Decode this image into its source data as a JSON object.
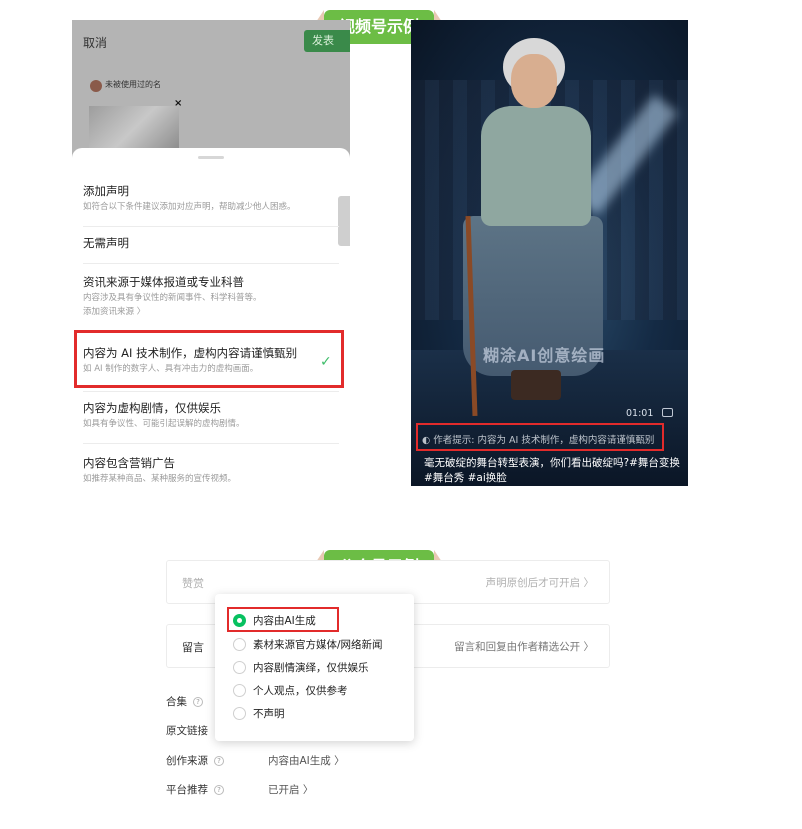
{
  "tags": {
    "video_account": "视频号示例",
    "official_account": "公众号示例"
  },
  "phone": {
    "cancel": "取消",
    "publish": "发表",
    "unused_name": "未被使用过的名",
    "close_symbol": "×",
    "declaration_header": "添加声明",
    "declaration_hint": "如符合以下条件建议添加对应声明，帮助减少他人困惑。",
    "options": [
      {
        "title": "无需声明",
        "subtitle": ""
      },
      {
        "title": "资讯来源于媒体报道或专业科普",
        "subtitle": "内容涉及具有争议性的新闻事件、科学科普等。",
        "extra": "添加资讯来源 〉"
      },
      {
        "title": "内容为 AI 技术制作，虚构内容请谨慎甄别",
        "subtitle": "如 AI 制作的数字人、具有冲击力的虚构画面。",
        "selected": true
      },
      {
        "title": "内容为虚构剧情，仅供娱乐",
        "subtitle": "如具有争议性、可能引起误解的虚构剧情。"
      },
      {
        "title": "内容包含营销广告",
        "subtitle": "如推荐某种商品、某种服务的宣传视频。"
      }
    ],
    "check_symbol": "✓"
  },
  "video": {
    "watermark": "糊涂AI创意绘画",
    "duration": "01:01",
    "warning": "◐ 作者提示: 内容为 AI 技术制作，虚构内容请谨慎甄别",
    "caption": "毫无破绽的舞台转型表演，你们看出破绽吗?#舞台变换 #舞台秀 #ai换脸"
  },
  "settings": {
    "appreciate": {
      "label": "赞赏",
      "value": "声明原创后才可开启 〉"
    },
    "comments": {
      "label": "留言",
      "value": "留言和回复由作者精选公开 〉"
    },
    "rows": [
      {
        "label": "合集",
        "value": ""
      },
      {
        "label": "原文链接",
        "value": ""
      },
      {
        "label": "创作来源",
        "value": "内容由AI生成 〉"
      },
      {
        "label": "平台推荐",
        "value": "已开启 〉"
      }
    ],
    "help_symbol": "?",
    "source_options": [
      {
        "label": "内容由AI生成",
        "selected": true
      },
      {
        "label": "素材来源官方媒体/网络新闻",
        "selected": false
      },
      {
        "label": "内容剧情演绎，仅供娱乐",
        "selected": false
      },
      {
        "label": "个人观点，仅供参考",
        "selected": false
      },
      {
        "label": "不声明",
        "selected": false
      }
    ]
  },
  "colors": {
    "tag_green": "#6cbd45",
    "highlight_red": "#e22b2b",
    "wechat_green": "#07c160"
  }
}
